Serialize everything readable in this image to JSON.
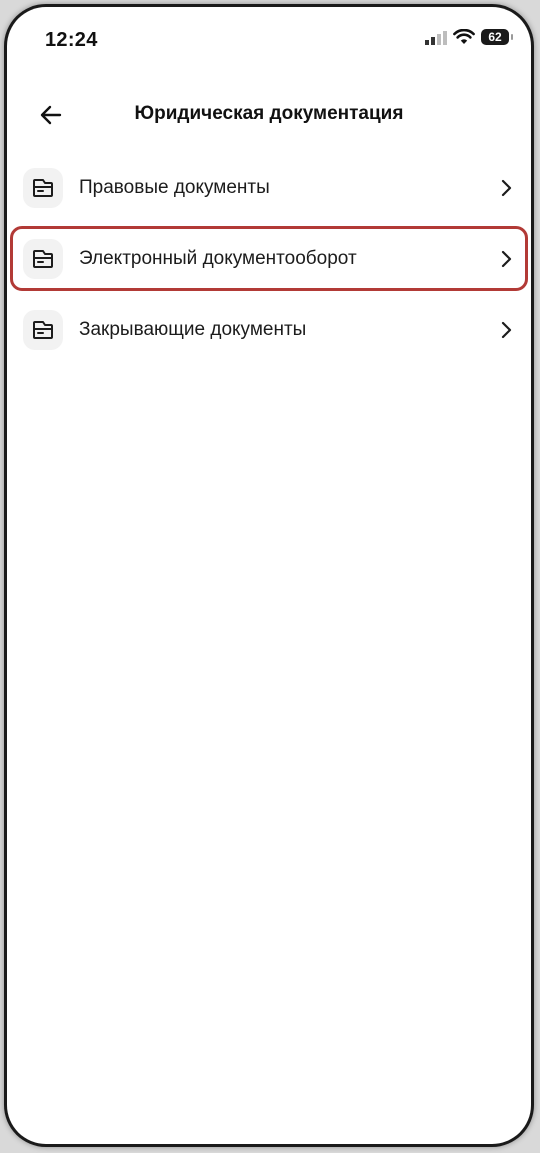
{
  "status_bar": {
    "time": "12:24",
    "battery": "62",
    "icons": [
      "signal-icon",
      "wifi-icon",
      "battery-icon"
    ]
  },
  "header": {
    "title": "Юридическая документация",
    "back_icon": "arrow-left-icon"
  },
  "menu": {
    "items": [
      {
        "label": "Правовые документы",
        "icon": "document-folder-icon",
        "highlighted": false
      },
      {
        "label": "Электронный документооборот",
        "icon": "document-folder-icon",
        "highlighted": true
      },
      {
        "label": "Закрывающие документы",
        "icon": "document-folder-icon",
        "highlighted": false
      }
    ]
  },
  "colors": {
    "highlight_border": "#b23a36",
    "icon_background": "#f2f2f2",
    "text": "#1c1c1c"
  }
}
